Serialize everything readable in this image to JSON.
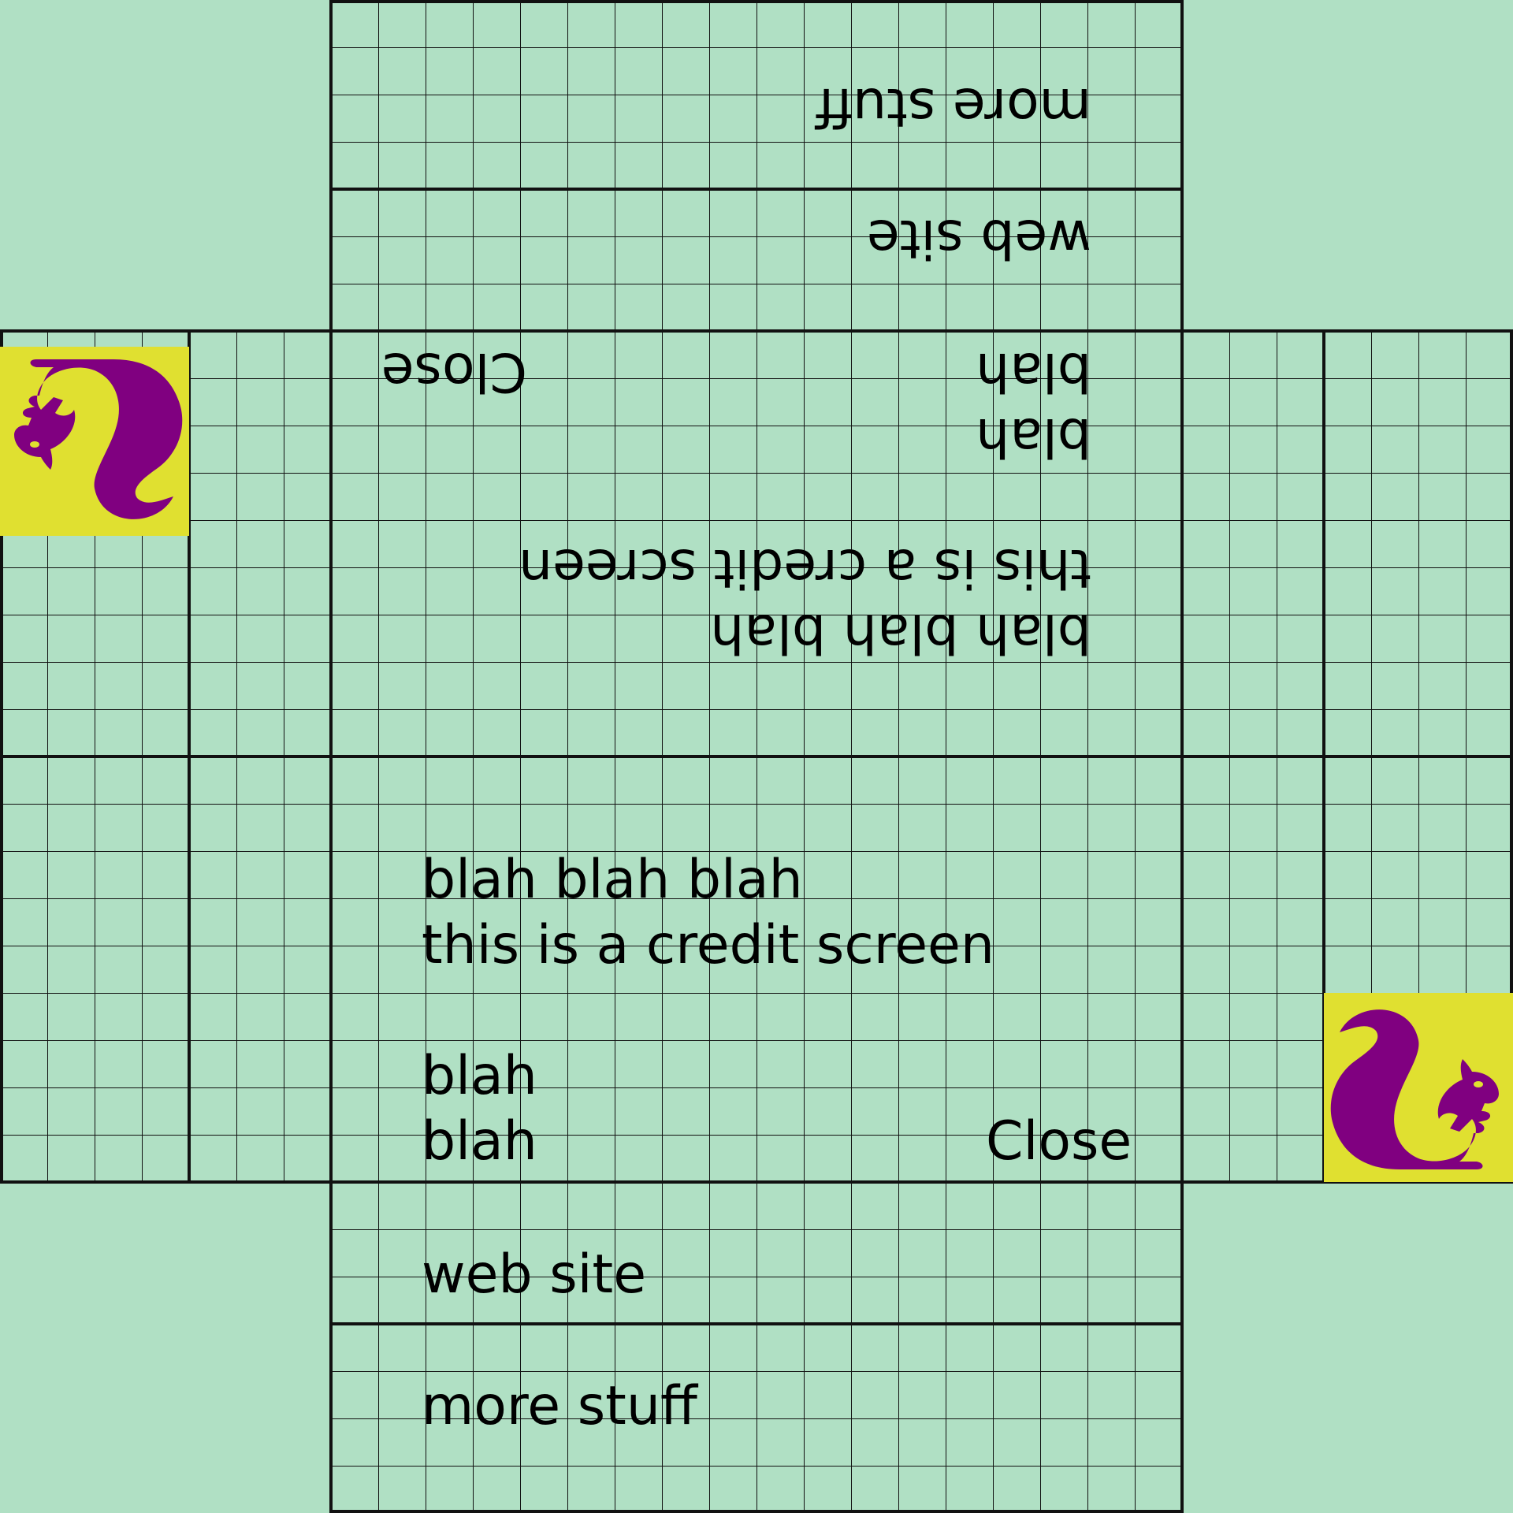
{
  "colors": {
    "background": "#b0e0c4",
    "grid_line": "#111111",
    "text": "#000000",
    "tile_background": "#e0e030",
    "squirrel": "#800080"
  },
  "credits": {
    "intro_line_1": "blah blah blah",
    "intro_line_2": "this is a credit screen",
    "body_line_1": "blah",
    "body_line_2": "blah",
    "close_label": "Close",
    "website_label": "web site",
    "more_label": "more stuff"
  },
  "icons": {
    "tile_icon": "squirrel-icon"
  }
}
